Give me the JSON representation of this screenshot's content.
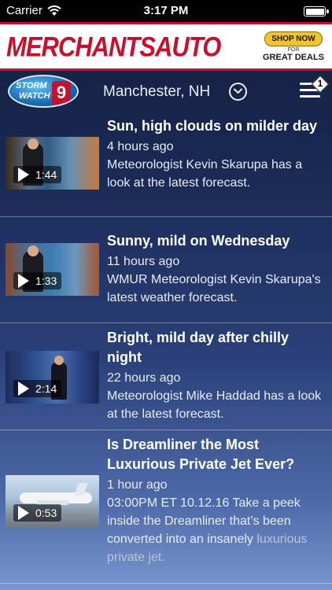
{
  "status_bar": {
    "carrier": "Carrier",
    "time": "3:17 PM"
  },
  "ad": {
    "brand": "MERCHANTSAUTO",
    "cta_top": "SHOP NOW",
    "cta_for": "FOR",
    "cta_bottom": "GREAT DEALS"
  },
  "nav": {
    "logo_top": "STORM",
    "logo_bottom": "WATCH",
    "logo_number": "9",
    "location": "Manchester, NH",
    "menu_badge": "1"
  },
  "videos": [
    {
      "title": "Sun, high clouds on milder day",
      "duration": "1:44",
      "age": "4 hours ago",
      "description": "Meteorologist Kevin Skarupa has a look at the latest forecast."
    },
    {
      "title": "Sunny, mild on Wednesday",
      "duration": "1:33",
      "age": "11 hours ago",
      "description": "WMUR Meteorologist Kevin Skarupa's latest weather forecast."
    },
    {
      "title": "Bright, mild day after chilly night",
      "duration": "2:14",
      "age": "22 hours ago",
      "description": "Meteorologist Mike Haddad has a look at the latest forecast."
    },
    {
      "title": "Is Dreamliner the Most Luxurious Private Jet Ever?",
      "duration": "0:53",
      "age": "1 hour ago",
      "description": "03:00PM ET 10.12.16 Take a peek inside the Dreamliner that’s been converted into an insanely",
      "description_fade": "luxurious private jet."
    }
  ],
  "colors": {
    "brand_red": "#c8102e",
    "background_top": "#141c3c",
    "background_bottom": "#7a97cf"
  }
}
